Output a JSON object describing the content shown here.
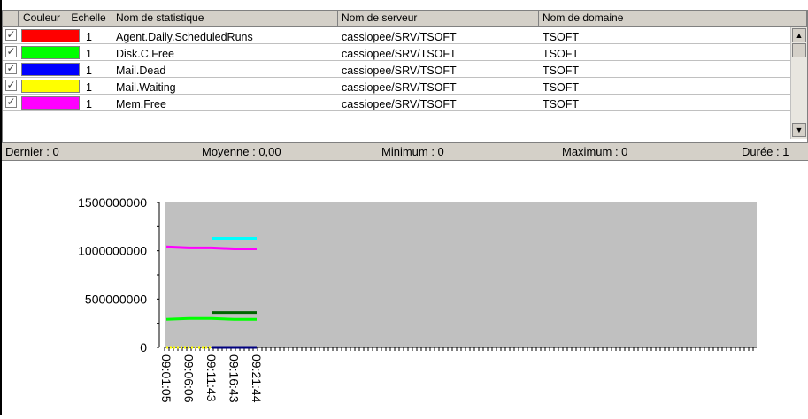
{
  "grid": {
    "headers": [
      "Couleur",
      "Echelle",
      "Nom de statistique",
      "Nom de serveur",
      "Nom de domaine"
    ],
    "rows": [
      {
        "checked": "✓",
        "color": "#ff0000",
        "scale": "1",
        "stat": "Agent.Daily.ScheduledRuns",
        "server": "cassiopee/SRV/TSOFT",
        "domain": "TSOFT"
      },
      {
        "checked": "✓",
        "color": "#00ff00",
        "scale": "1",
        "stat": "Disk.C.Free",
        "server": "cassiopee/SRV/TSOFT",
        "domain": "TSOFT"
      },
      {
        "checked": "✓",
        "color": "#0000ff",
        "scale": "1",
        "stat": "Mail.Dead",
        "server": "cassiopee/SRV/TSOFT",
        "domain": "TSOFT"
      },
      {
        "checked": "✓",
        "color": "#ffff00",
        "scale": "1",
        "stat": "Mail.Waiting",
        "server": "cassiopee/SRV/TSOFT",
        "domain": "TSOFT"
      },
      {
        "checked": "✓",
        "color": "#ff00ff",
        "scale": "1",
        "stat": "Mem.Free",
        "server": "cassiopee/SRV/TSOFT",
        "domain": "TSOFT"
      }
    ],
    "scroll_up": "▲",
    "scroll_down": "▼"
  },
  "status": {
    "last": "Dernier : 0",
    "average": "Moyenne : 0,00",
    "minimum": "Minimum : 0",
    "maximum": "Maximum : 0",
    "duration": "Durée : 1"
  },
  "chart_data": {
    "type": "line",
    "background": "#c0c0c0",
    "ylim": [
      0,
      1500000000
    ],
    "yticks": [
      0,
      500000000,
      1000000000,
      1500000000
    ],
    "ytick_labels": [
      "0",
      "500000000",
      "1000000000",
      "1500000000"
    ],
    "xtick_labels": [
      "09:01:05",
      "09:06:06",
      "09:11:43",
      "09:16:43",
      "09:21:44"
    ],
    "series": [
      {
        "color": "#ff00ff",
        "x": [
          0,
          1,
          2,
          3,
          4
        ],
        "y": [
          1040000000,
          1030000000,
          1030000000,
          1020000000,
          1020000000
        ]
      },
      {
        "color": "#00ffff",
        "x": [
          2,
          3,
          4
        ],
        "y": [
          1130000000,
          1130000000,
          1130000000
        ]
      },
      {
        "color": "#00ff00",
        "x": [
          0,
          1,
          2,
          3,
          4
        ],
        "y": [
          290000000,
          300000000,
          300000000,
          290000000,
          290000000
        ]
      },
      {
        "color": "#006400",
        "x": [
          2,
          3,
          4
        ],
        "y": [
          360000000,
          360000000,
          360000000
        ]
      },
      {
        "color": "#ffff00",
        "x": [
          0,
          1,
          2
        ],
        "y": [
          0,
          0,
          0
        ],
        "dashed": true
      },
      {
        "color": "#000080",
        "x": [
          2,
          3,
          4
        ],
        "y": [
          0,
          0,
          0
        ]
      }
    ]
  }
}
